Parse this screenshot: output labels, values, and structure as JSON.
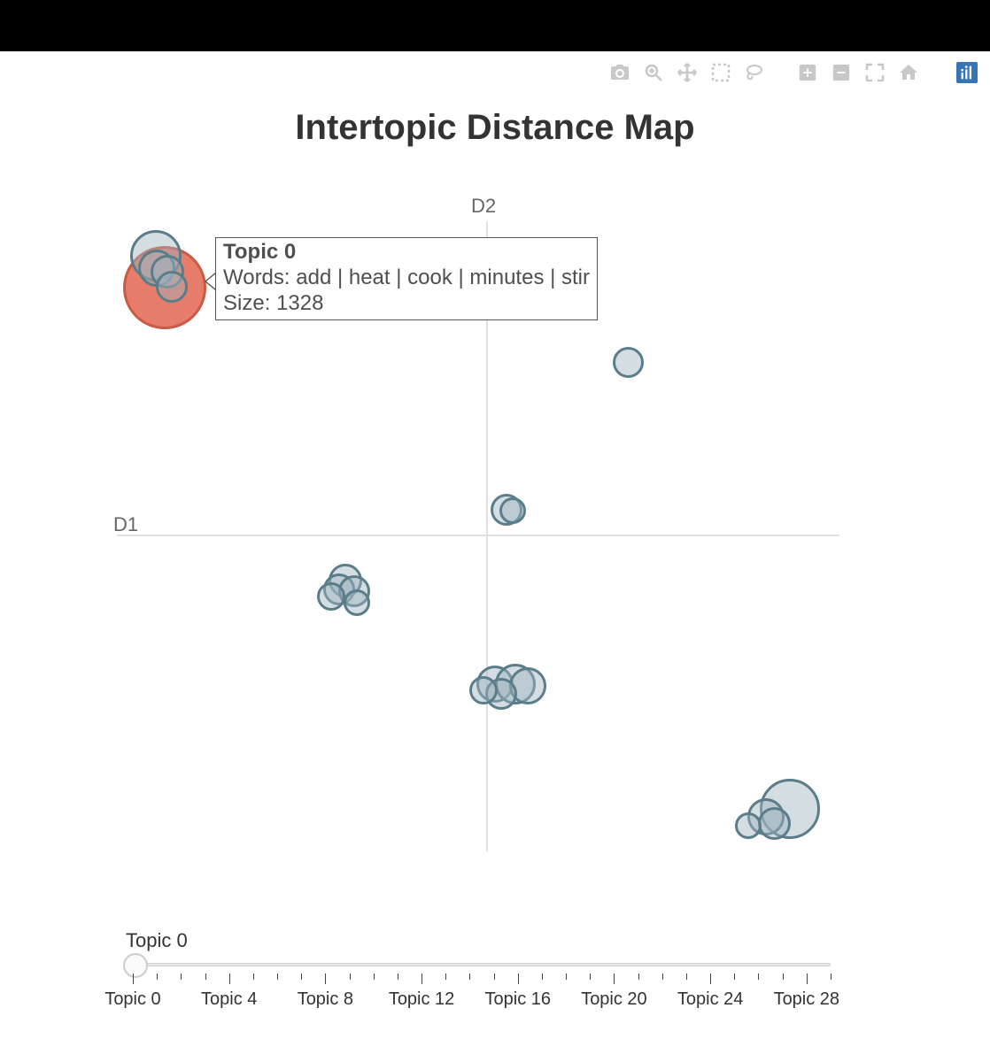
{
  "title": "Intertopic Distance Map",
  "axis_labels": {
    "x": "D1",
    "y": "D2"
  },
  "tooltip": {
    "title": "Topic 0",
    "words_label": "Words: ",
    "words": "add | heat | cook | minutes | stir",
    "size_label": "Size: ",
    "size": "1328"
  },
  "slider": {
    "label": "Topic 0",
    "min": 0,
    "max": 29,
    "value": 0,
    "tick_labels": [
      "Topic 0",
      "Topic 4",
      "Topic 8",
      "Topic 12",
      "Topic 16",
      "Topic 20",
      "Topic 24",
      "Topic 28"
    ]
  },
  "toolbar": [
    "camera",
    "zoom",
    "pan",
    "box-select",
    "lasso",
    "zoom-in",
    "zoom-out",
    "autoscale",
    "home",
    "plotly-logo"
  ],
  "chart_data": {
    "type": "scatter",
    "title": "Intertopic Distance Map",
    "xlabel": "D1",
    "ylabel": "D2",
    "xlim": [
      -10,
      10
    ],
    "ylim": [
      -9,
      9
    ],
    "series": [
      {
        "name": "selected",
        "points": [
          {
            "topic": 0,
            "x": -9.0,
            "y": 6.5,
            "size": 1328
          }
        ]
      },
      {
        "name": "topics",
        "points": [
          {
            "topic": 1,
            "x": -9.3,
            "y": 7.2,
            "size": 600
          },
          {
            "topic": 2,
            "x": -9.1,
            "y": 6.7,
            "size": 350
          },
          {
            "topic": 3,
            "x": -8.8,
            "y": 6.6,
            "size": 300
          },
          {
            "topic": 4,
            "x": -8.7,
            "y": 6.2,
            "size": 300
          },
          {
            "topic": 5,
            "x": 3.8,
            "y": 4.7,
            "size": 250
          },
          {
            "topic": 6,
            "x": 0.5,
            "y": 0.7,
            "size": 280
          },
          {
            "topic": 7,
            "x": 0.7,
            "y": 0.7,
            "size": 220
          },
          {
            "topic": 8,
            "x": -3.8,
            "y": -1.2,
            "size": 280
          },
          {
            "topic": 9,
            "x": -3.9,
            "y": -1.4,
            "size": 260
          },
          {
            "topic": 10,
            "x": -3.6,
            "y": -1.5,
            "size": 260
          },
          {
            "topic": 11,
            "x": -4.1,
            "y": -1.6,
            "size": 240
          },
          {
            "topic": 12,
            "x": -3.5,
            "y": -1.8,
            "size": 220
          },
          {
            "topic": 13,
            "x": 0.1,
            "y": -4.0,
            "size": 300
          },
          {
            "topic": 14,
            "x": 0.6,
            "y": -4.0,
            "size": 340
          },
          {
            "topic": 15,
            "x": 0.9,
            "y": -4.1,
            "size": 300
          },
          {
            "topic": 16,
            "x": 0.3,
            "y": -4.3,
            "size": 260
          },
          {
            "topic": 17,
            "x": -0.1,
            "y": -4.3,
            "size": 240
          },
          {
            "topic": 18,
            "x": 8.6,
            "y": -7.1,
            "size": 600
          },
          {
            "topic": 19,
            "x": 8.1,
            "y": -7.4,
            "size": 320
          },
          {
            "topic": 20,
            "x": 8.3,
            "y": -7.6,
            "size": 280
          },
          {
            "topic": 21,
            "x": 7.9,
            "y": -7.7,
            "size": 220
          }
        ]
      }
    ]
  }
}
